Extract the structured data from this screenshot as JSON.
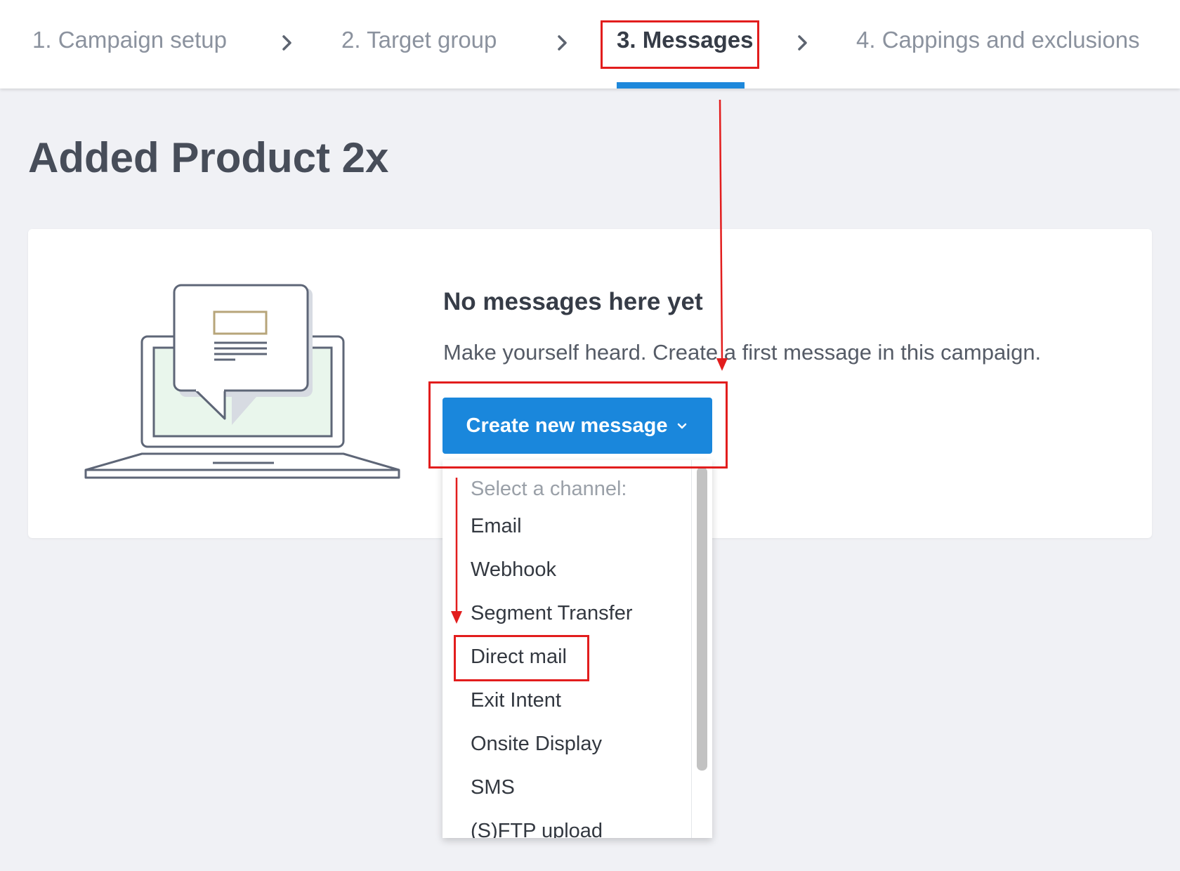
{
  "steps": [
    {
      "label": "1. Campaign setup"
    },
    {
      "label": "2. Target group"
    },
    {
      "label": "3. Messages"
    },
    {
      "label": "4. Cappings and exclusions"
    }
  ],
  "active_step": "3. Messages",
  "page_title": "Added Product 2x",
  "empty_state": {
    "title": "No messages here yet",
    "description": "Make yourself heard. Create a first message in this campaign.",
    "button_label": "Create new message"
  },
  "channel_menu": {
    "header": "Select a channel:",
    "items": [
      "Email",
      "Webhook",
      "Segment Transfer",
      "Direct mail",
      "Exit Intent",
      "Onsite Display",
      "SMS",
      "(S)FTP upload"
    ],
    "highlighted_item": "Direct mail"
  },
  "colors": {
    "primary": "#1a87dc",
    "annotation": "#e21d1d",
    "background": "#f0f1f5"
  },
  "icons": [
    "chevron-right-icon",
    "chevron-down-icon",
    "laptop-message-illustration"
  ]
}
